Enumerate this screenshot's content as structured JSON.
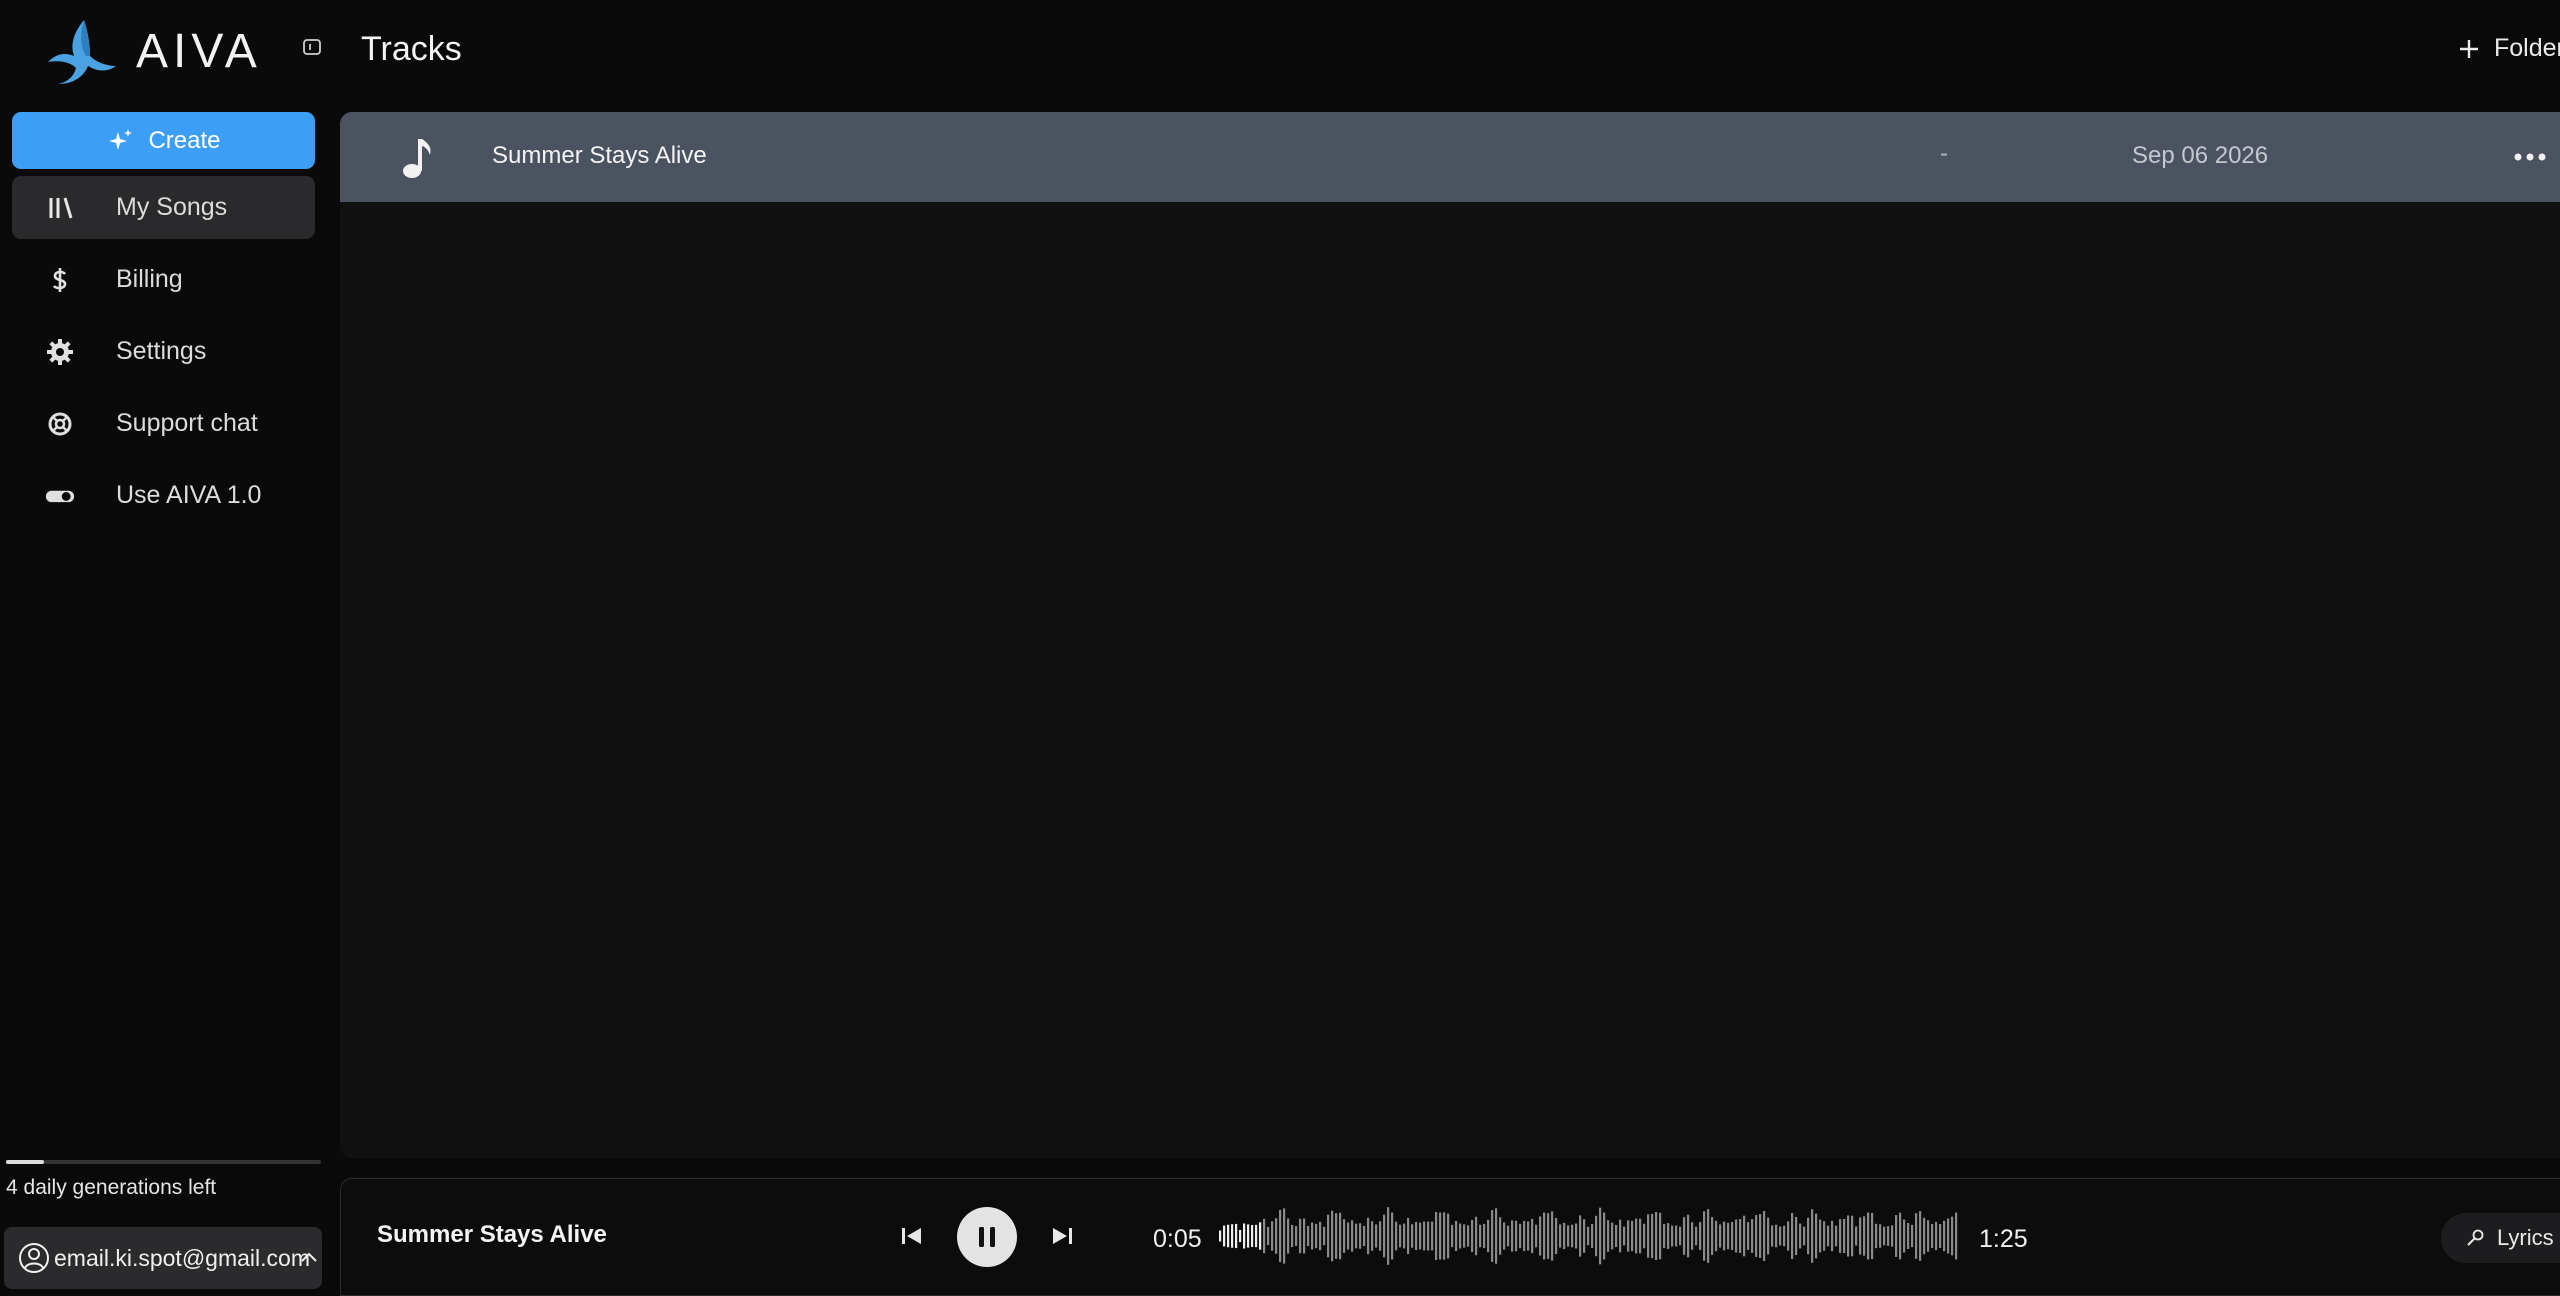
{
  "app": {
    "name": "AIVA"
  },
  "header": {
    "title": "Tracks",
    "folder_label": "Folder"
  },
  "sidebar": {
    "create_label": "Create",
    "items": [
      {
        "label": "My Songs",
        "icon": "library-icon",
        "active": true
      },
      {
        "label": "Billing",
        "icon": "dollar-icon",
        "active": false
      },
      {
        "label": "Settings",
        "icon": "gear-icon",
        "active": false
      },
      {
        "label": "Support chat",
        "icon": "lifebuoy-icon",
        "active": false
      },
      {
        "label": "Use AIVA 1.0",
        "icon": "toggle-icon",
        "active": false
      }
    ],
    "quota_text": "4 daily generations left",
    "quota_fraction": 0.12,
    "account_email": "email.ki.spot@gmail.com"
  },
  "tracks": [
    {
      "title": "Summer Stays Alive",
      "genre": "-",
      "date": "Sep 06 2026"
    }
  ],
  "player": {
    "title": "Summer Stays Alive",
    "current_time": "0:05",
    "total_time": "1:25",
    "progress_fraction": 0.06,
    "lyrics_label": "Lyrics"
  },
  "colors": {
    "accent": "#3d9ef5",
    "row_selected": "#4b5260",
    "background": "#0a0a0b"
  }
}
